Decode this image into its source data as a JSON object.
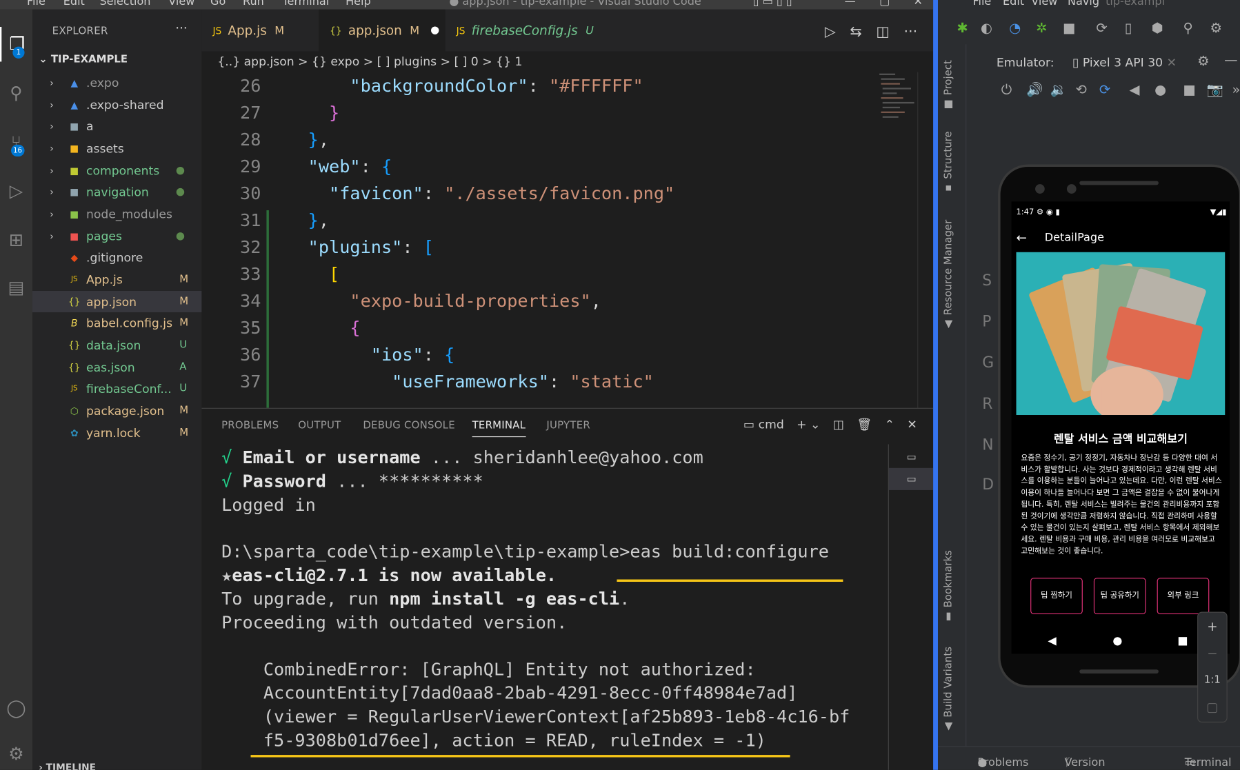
{
  "vscode": {
    "menu": [
      "File",
      "Edit",
      "Selection",
      "View",
      "Go",
      "Run",
      "Terminal",
      "Help"
    ],
    "window_title": "● app.json - tip-example - Visual Studio Code",
    "activity_badges": {
      "explorer": "1",
      "scm": "16"
    },
    "explorer": {
      "header": "EXPLORER",
      "more": "···",
      "folder": "TIP-EXAMPLE",
      "items": [
        {
          "name": ".expo",
          "status": ""
        },
        {
          "name": ".expo-shared",
          "status": ""
        },
        {
          "name": "a",
          "status": ""
        },
        {
          "name": "assets",
          "status": ""
        },
        {
          "name": "components",
          "status": "●"
        },
        {
          "name": "navigation",
          "status": "●"
        },
        {
          "name": "node_modules",
          "status": ""
        },
        {
          "name": "pages",
          "status": "●"
        },
        {
          "name": ".gitignore",
          "status": ""
        },
        {
          "name": "App.js",
          "status": "M"
        },
        {
          "name": "app.json",
          "status": "M"
        },
        {
          "name": "babel.config.js",
          "status": "M"
        },
        {
          "name": "data.json",
          "status": "U"
        },
        {
          "name": "eas.json",
          "status": "A"
        },
        {
          "name": "firebaseConf...",
          "status": "U"
        },
        {
          "name": "package.json",
          "status": "M"
        },
        {
          "name": "yarn.lock",
          "status": "M"
        }
      ],
      "timeline": "TIMELINE"
    },
    "tabs": [
      {
        "name": "App.js",
        "status": "M"
      },
      {
        "name": "app.json",
        "status": "M"
      },
      {
        "name": "firebaseConfig.js",
        "status": "U"
      }
    ],
    "breadcrumb": "{..} app.json > {} expo > [ ] plugins > [ ] 0 > {} 1",
    "lines": [
      "26",
      "27",
      "28",
      "29",
      "30",
      "31",
      "32",
      "33",
      "34",
      "35",
      "36",
      "37"
    ],
    "code": {
      "l26k": "\"backgroundColor\"",
      "l26v": "\"#FFFFFF\"",
      "l29k": "\"web\"",
      "l30k": "\"favicon\"",
      "l30v": "\"./assets/favicon.png\"",
      "l32k": "\"plugins\"",
      "l34v": "\"expo-build-properties\"",
      "l36k": "\"ios\"",
      "l37k": "\"useFrameworks\"",
      "l37v": "\"static\""
    },
    "panel": {
      "tabs": [
        "PROBLEMS",
        "OUTPUT",
        "DEBUG CONSOLE",
        "TERMINAL",
        "JUPYTER"
      ],
      "shell": "cmd",
      "terminal": {
        "check": "√",
        "email_label": "Email or username",
        "email_dots": " ... ",
        "email": "sheridanhlee@yahoo.com",
        "password_label": "Password",
        "password_dots": " ... ",
        "password": "**********",
        "logged": "Logged in",
        "prompt": "D:\\sparta_code\\tip-example\\tip-example>eas build:configure",
        "star": "★",
        "available": "eas-cli@2.7.1 is now available.",
        "upgrade_pre": "To upgrade, run ",
        "upgrade_cmd": "npm install -g eas-cli",
        "upgrade_post": ".",
        "proceed": "Proceeding with outdated version.",
        "err1": "    CombinedError: [GraphQL] Entity not authorized:",
        "err2": "    AccountEntity[7dad0aa8-2bab-4291-8ecc-0ff48984e7ad]",
        "err3": "    (viewer = RegularUserViewerContext[af25b893-1eb8-4c16-bf",
        "err4": "    f5-9308b01d76ee], action = READ, ruleIndex = -1)"
      }
    }
  },
  "android_studio": {
    "menu": [
      "File",
      "Edit",
      "View",
      "Navig",
      "tip-exampl"
    ],
    "side_tools": [
      "Project",
      "Structure",
      "Resource Manager",
      "Bookmarks",
      "Build Variants"
    ],
    "letters": [
      "S",
      "P",
      "G",
      "R",
      "N",
      "D"
    ],
    "emulator_label": "Emulator:",
    "device": "Pixel 3 API 30",
    "phone": {
      "time": "1:47",
      "title": "DetailPage",
      "heading": "렌탈 서비스 금액 비교해보기",
      "body": "요즘은 정수기, 공기 정정기, 자동차나 장난감 등 다양한 대여 서비스가 활발합니다. 사는 것보다 경제적이라고 생각해 렌탈 서비스를 이용하는 분들이 늘어나고 있는데요. 다만, 이런 렌탈 서비스 이용이 하나들 늘어나다 보면 그 금액은 걸잡을 수 없이 불어나게 됩니다. 특히, 렌탈 서비스는 빌려주는 물건의 관리비용까지 포함된 것이기에 생각만큼 저렴하지 않습니다. 직접 관리하며 사용할 수 있는 물건이 있는지 살펴보고, 렌탈 서비스 항목에서 제외해보세요. 렌탈 비용과 구매 비용, 관리 비용을 여러모로 비교해보고 고민해보는 것이 좋습니다.",
      "buttons": [
        "팁 찜하기",
        "팁 공유하기",
        "외부 링크"
      ]
    },
    "zoom": [
      "+",
      "−",
      "1:1"
    ],
    "bottom": [
      "Problems",
      "Version Control",
      "Terminal"
    ]
  }
}
